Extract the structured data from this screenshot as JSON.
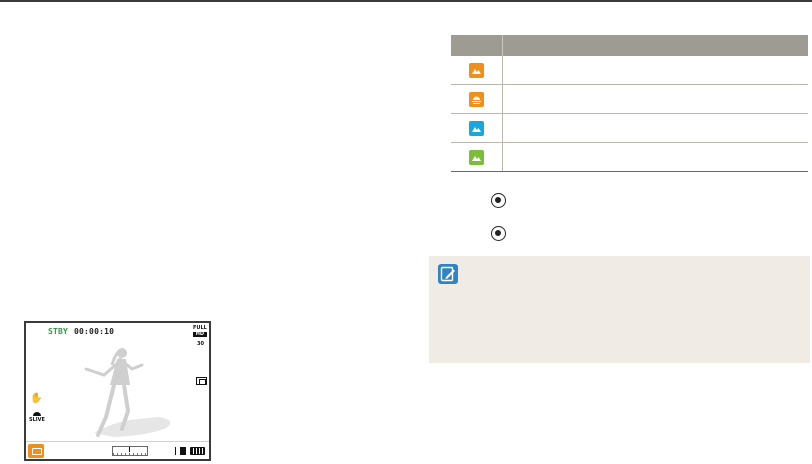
{
  "lcd": {
    "status": "STBY",
    "time": "00:00:10",
    "resolution_top": "FULL",
    "resolution_bottom": "HD",
    "fps": "30",
    "smart_filter": "SLIVE"
  },
  "table": {
    "header": [
      "",
      ""
    ],
    "rows": [
      {
        "icon": "landscape-scene-icon",
        "color": "#ef8f1c"
      },
      {
        "icon": "sunset-scene-icon",
        "color": "#ef8f1c"
      },
      {
        "icon": "blue-sky-scene-icon",
        "color": "#1aa7dd"
      },
      {
        "icon": "natural-green-scene-icon",
        "color": "#7cbd3a"
      }
    ]
  },
  "steps": {
    "step1_icon": "shutter-button-icon",
    "step2_icon": "shutter-button-icon"
  },
  "note": {
    "icon": "note-pencil-icon",
    "accent_color": "#2f83c6",
    "background_color": "#f1ebe6"
  }
}
